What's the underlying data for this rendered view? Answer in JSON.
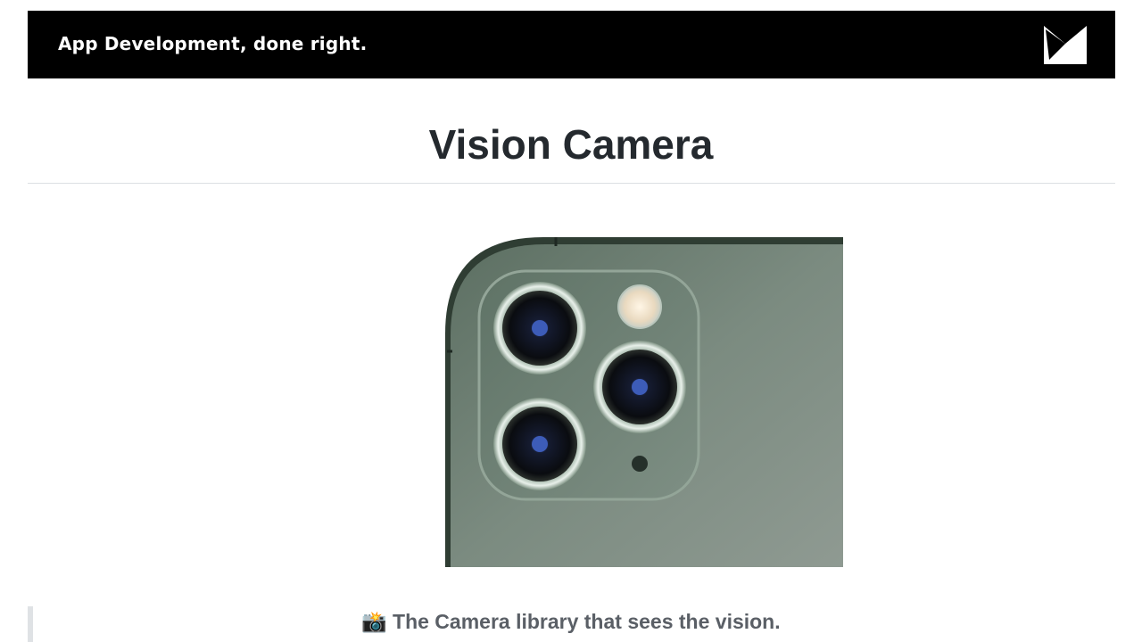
{
  "banner": {
    "text": "App Development, done right.",
    "logo_icon": "mrousavy-logo-icon"
  },
  "page": {
    "title": "Vision Camera",
    "hero_image": "iphone-triple-camera-image",
    "tagline_emoji": "📸",
    "tagline": "The Camera library that sees the vision."
  },
  "colors": {
    "banner_bg": "#000000",
    "title": "#24292e",
    "divider": "#dcdfe3",
    "tagline": "#5a5f66",
    "quote_bar": "#dfe2e5",
    "phone_body": "#6f8076"
  }
}
